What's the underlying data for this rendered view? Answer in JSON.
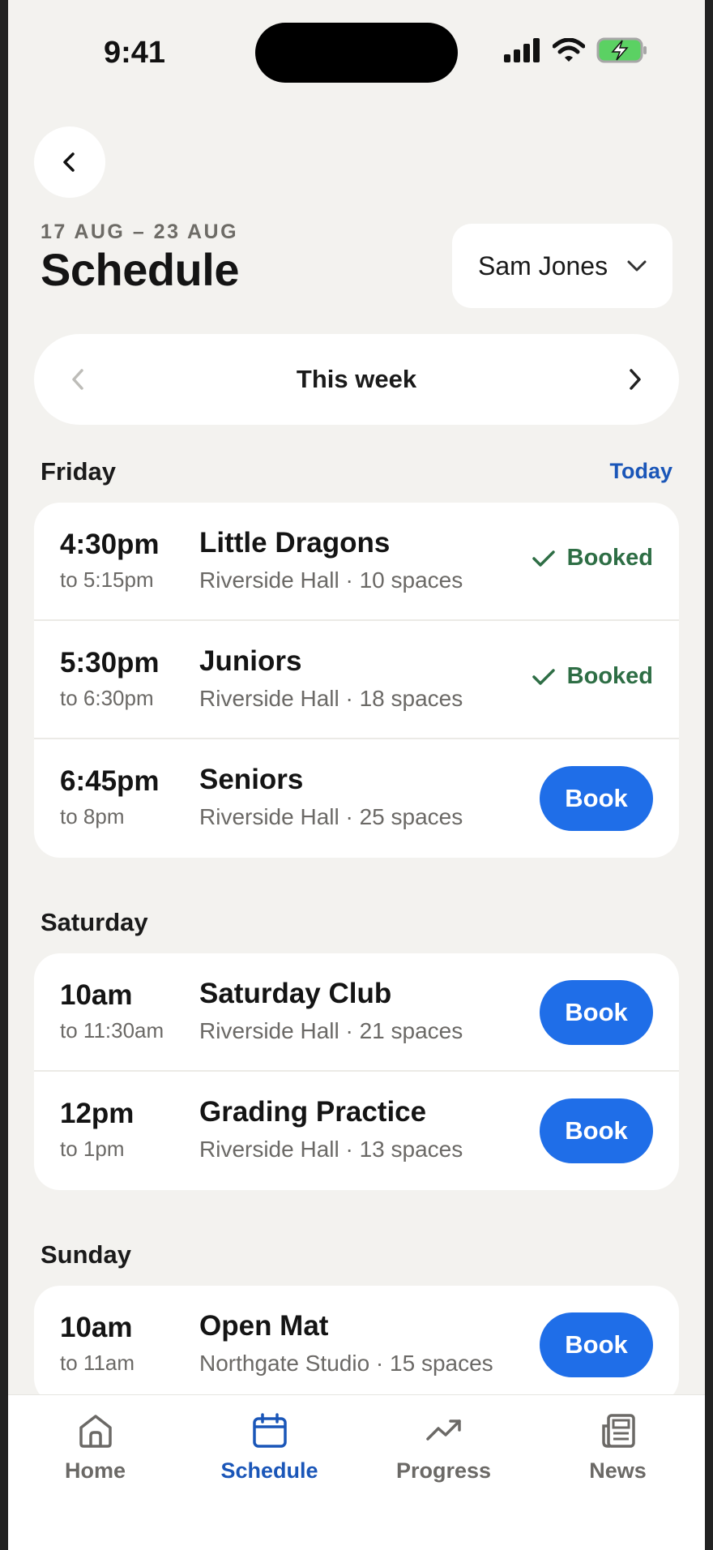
{
  "status_bar": {
    "time": "9:41"
  },
  "header": {
    "date_range": "17 AUG – 23 AUG",
    "title": "Schedule",
    "user": "Sam Jones"
  },
  "week_nav": {
    "label": "This week"
  },
  "today_label": "Today",
  "days": [
    {
      "name": "Friday",
      "classes": [
        {
          "start": "4:30pm",
          "end": "to 5:15pm",
          "name": "Little Dragons",
          "meta": "Riverside Hall · 10 spaces",
          "status": "Booked"
        },
        {
          "start": "5:30pm",
          "end": "to 6:30pm",
          "name": "Juniors",
          "meta": "Riverside Hall · 18 spaces",
          "status": "Booked"
        },
        {
          "start": "6:45pm",
          "end": "to 8pm",
          "name": "Seniors",
          "meta": "Riverside Hall · 25 spaces",
          "action": "Book"
        }
      ]
    },
    {
      "name": "Saturday",
      "classes": [
        {
          "start": "10am",
          "end": "to 11:30am",
          "name": "Saturday Club",
          "meta": "Riverside Hall · 21 spaces",
          "action": "Book"
        },
        {
          "start": "12pm",
          "end": "to 1pm",
          "name": "Grading Practice",
          "meta": "Riverside Hall · 13 spaces",
          "action": "Book"
        }
      ]
    },
    {
      "name": "Sunday",
      "classes": [
        {
          "start": "10am",
          "end": "to 11am",
          "name": "Open Mat",
          "meta": "Northgate Studio · 15 spaces",
          "action": "Book"
        }
      ]
    }
  ],
  "tabs": [
    {
      "label": "Home",
      "icon": "home-icon"
    },
    {
      "label": "Schedule",
      "icon": "calendar-icon",
      "active": true
    },
    {
      "label": "Progress",
      "icon": "trend-up-icon"
    },
    {
      "label": "News",
      "icon": "newspaper-icon"
    }
  ],
  "colors": {
    "accent": "#1f6ee8",
    "link": "#1a56b8",
    "booked": "#2e6e45",
    "background": "#f3f2ef"
  }
}
